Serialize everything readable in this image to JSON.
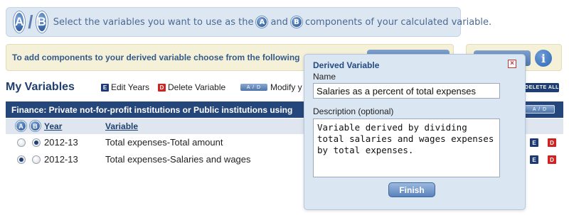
{
  "banner": {
    "a_letter": "A",
    "b_letter": "B",
    "slash": "/",
    "text_part1": "Select the variables you want to use as the",
    "text_part2": "and",
    "text_part3": "components of your calculated variable."
  },
  "info_bar": {
    "text": "To add components to your derived variable choose from the following"
  },
  "info_icon": "i",
  "my_variables": {
    "title": "My Variables",
    "edit_years": "Edit Years",
    "delete_variable": "Delete Variable",
    "ad_label": "A / D",
    "modify": "Modify y",
    "delete_all": "DELETE ALL"
  },
  "finance_header": {
    "text": "Finance: Private not-for-profit institutions or Public institutions using",
    "ad_label": "A / D"
  },
  "columns": {
    "year": "Year",
    "variable": "Variable"
  },
  "rows": [
    {
      "year": "2012-13",
      "variable": "Total expenses-Total amount",
      "a_selected": false,
      "b_selected": true
    },
    {
      "year": "2012-13",
      "variable": "Total expenses-Salaries and wages",
      "a_selected": true,
      "b_selected": false
    }
  ],
  "icons": {
    "edit": "E",
    "delete": "D"
  },
  "dialog": {
    "title": "Derived Variable",
    "close": "×",
    "name_label": "Name",
    "name_value": "Salaries as a percent of total expenses",
    "description_label": "Description (optional)",
    "description_value": "Variable derived by dividing total salaries and wages expenses by total expenses.",
    "finish": "Finish"
  },
  "colors": {
    "navy": "#25467a",
    "banner_bg": "#dde7f2",
    "info_bg": "#f5f1d8",
    "delete_red": "#d12222"
  }
}
